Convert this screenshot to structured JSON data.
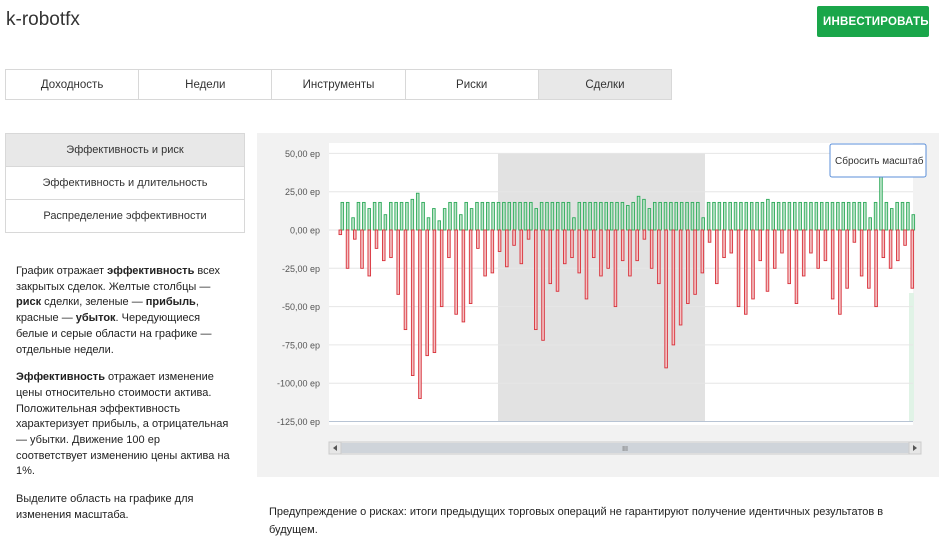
{
  "brand": "k-robotfx",
  "invest_button": "ИНВЕСТИРОВАТЬ",
  "tabs": [
    {
      "label": "Доходность"
    },
    {
      "label": "Недели"
    },
    {
      "label": "Инструменты"
    },
    {
      "label": "Риски"
    },
    {
      "label": "Сделки",
      "active": true
    }
  ],
  "side_menu": [
    {
      "label": "Эффективность и риск",
      "active": true
    },
    {
      "label": "Эффективность и длительность"
    },
    {
      "label": "Распределение эффективности"
    }
  ],
  "description": {
    "p1": [
      {
        "t": "График отражает ",
        "b": false
      },
      {
        "t": "эффективность",
        "b": true
      },
      {
        "t": " всех закрытых сделок. Желтые столбцы — ",
        "b": false
      },
      {
        "t": "риск",
        "b": true
      },
      {
        "t": " сделки, зеленые — ",
        "b": false
      },
      {
        "t": "прибыль",
        "b": true
      },
      {
        "t": ", красные — ",
        "b": false
      },
      {
        "t": "убыток",
        "b": true
      },
      {
        "t": ". Чередующиеся белые и серые области на графике — отдельные недели.",
        "b": false
      }
    ],
    "p2": [
      {
        "t": "Эффективность",
        "b": true
      },
      {
        "t": " отражает изменение цены относительно стоимости актива. Положительная эффективность характеризует прибыль, а отрицательная — убытки. Движение 100 ер соответствует изменению цены актива на 1%.",
        "b": false
      }
    ],
    "p3": "Выделите область на графике для изменения масштаба."
  },
  "warning": "Предупреждение о рисках: итоги предыдущих торговых операций не гарантируют получение идентичных результатов в будущем.",
  "reset_zoom_label": "Сбросить масштаб",
  "colors": {
    "profit": "#2eaa5a",
    "loss": "#d9313a",
    "accent": "#1aa64a"
  },
  "chart_data": {
    "type": "bar",
    "y_tick_labels": [
      "50,00 ер",
      "25,00 ер",
      "0,00 ер",
      "-25,00 ер",
      "-50,00 ер",
      "-75,00 ер",
      "-100,00 ер",
      "-125,00 ер"
    ],
    "ylim": [
      -125,
      50
    ],
    "grid": true,
    "scrollbar_grip": "III",
    "series": [
      {
        "name": "profit",
        "values": [
          18,
          18,
          8,
          18,
          18,
          14,
          18,
          18,
          10,
          18,
          18,
          18,
          18,
          20,
          24,
          18,
          8,
          14,
          6,
          14,
          18,
          18,
          10,
          18,
          14,
          18,
          18,
          18,
          18,
          18,
          18,
          18,
          18,
          18,
          18,
          18,
          14,
          18,
          18,
          18,
          18,
          18,
          18,
          8,
          18,
          18,
          18,
          18,
          18,
          18,
          18,
          18,
          18,
          16,
          18,
          22,
          20,
          14,
          18,
          18,
          18,
          18,
          18,
          18,
          18,
          18,
          18,
          8,
          18,
          18,
          18,
          18,
          18,
          18,
          18,
          18,
          18,
          18,
          18,
          20,
          18,
          18,
          18,
          18,
          18,
          18,
          18,
          18,
          18,
          18,
          18,
          18,
          18,
          18,
          18,
          18,
          18,
          18,
          8,
          18,
          35,
          18,
          14,
          18,
          18,
          18,
          10
        ]
      },
      {
        "name": "loss",
        "values": [
          -3,
          -25,
          -6,
          -25,
          -30,
          -12,
          -20,
          -18,
          -42,
          -65,
          -95,
          -110,
          -82,
          -80,
          -50,
          -18,
          -55,
          -60,
          -48,
          -12,
          -30,
          -28,
          -14,
          -24,
          -10,
          -22,
          -6,
          -65,
          -72,
          -35,
          -40,
          -22,
          -18,
          -28,
          -45,
          -18,
          -30,
          -25,
          -50,
          -20,
          -30,
          -20,
          -6,
          -25,
          -35,
          -90,
          -75,
          -62,
          -48,
          -42,
          -28,
          -8,
          -35,
          -18,
          -15,
          -50,
          -55,
          -45,
          -20,
          -40,
          -25,
          -15,
          -35,
          -48,
          -30,
          -15,
          -25,
          -20,
          -45,
          -55,
          -38,
          -8,
          -30,
          -38,
          -50,
          -18,
          -25,
          -20,
          -10,
          -38
        ]
      }
    ]
  }
}
